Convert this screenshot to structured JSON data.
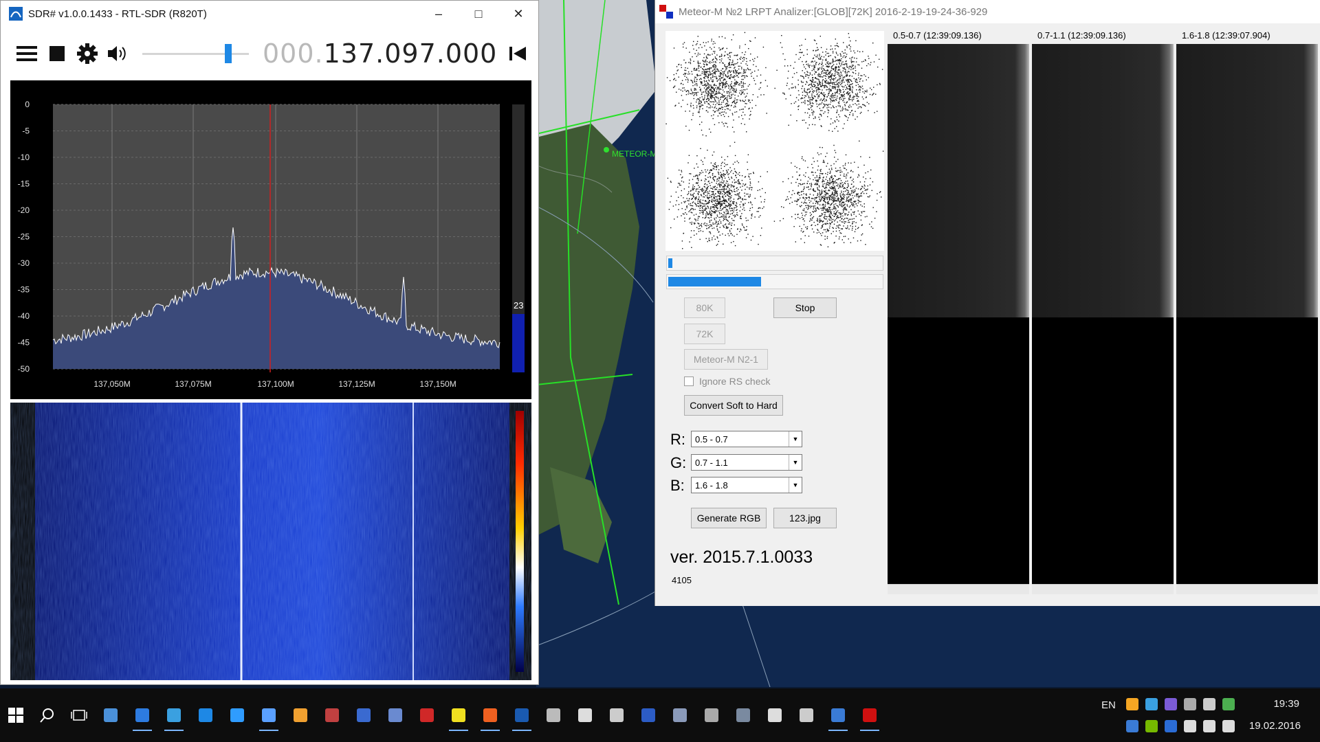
{
  "sdr": {
    "title": "SDR# v1.0.0.1433 - RTL-SDR (R820T)",
    "freq_lead": "000.",
    "freq_main": "137.097.000",
    "spectrum": {
      "y_ticks": [
        "0",
        "-5",
        "-10",
        "-15",
        "-20",
        "-25",
        "-30",
        "-35",
        "-40",
        "-45",
        "-50"
      ],
      "x_ticks": [
        "137,050M",
        "137,075M",
        "137,100M",
        "137,125M",
        "137,150M"
      ],
      "level_value": "23"
    },
    "colors": {
      "trace": "#ffffff",
      "fill": "#3b4a7a",
      "cursor": "#d02020",
      "waterfall_bg": "#0a1a8a"
    }
  },
  "meteor": {
    "title": "Meteor-M №2 LRPT Analizer:[GLOB][72K] 2016-2-19-19-24-36-929",
    "progress1": 0.02,
    "progress2": 0.43,
    "btn_80k": "80K",
    "btn_72k": "72K",
    "btn_stop": "Stop",
    "btn_meteor": "Meteor-M N2-1",
    "ignore_rs": "Ignore RS check",
    "btn_convert": "Convert Soft to Hard",
    "r_label": "R:",
    "g_label": "G:",
    "b_label": "B:",
    "r_value": "0.5 - 0.7",
    "g_value": "0.7 - 1.1",
    "b_value": "1.6 - 1.8",
    "btn_generate": "Generate RGB",
    "btn_jpg": "123.jpg",
    "version": "ver. 2015.7.1.0033",
    "counter": "4105",
    "channels": [
      {
        "label": "0.5-0.7 (12:39:09.136)"
      },
      {
        "label": "0.7-1.1 (12:39:09.136)"
      },
      {
        "label": "1.6-1.8 (12:39:07.904)"
      }
    ]
  },
  "map": {
    "label": "METEOR-M"
  },
  "taskbar": {
    "icons": [
      "ship-icon",
      "store-icon",
      "globe-icon",
      "appstore-icon",
      "edge-icon",
      "search-app-icon",
      "orb-icon",
      "chart-icon",
      "sphere-icon",
      "network-icon",
      "pdf-icon",
      "ball-icon",
      "star-icon",
      "screen-icon",
      "terminal-icon",
      "barcode-icon",
      "media-icon",
      "photoshop-icon",
      "notes-icon",
      "feather-icon",
      "film-icon",
      "sound-icon",
      "pen-icon",
      "robot-icon",
      "meteor-app-icon"
    ],
    "lang": "EN",
    "time": "19:39",
    "date": "19.02.2016"
  }
}
